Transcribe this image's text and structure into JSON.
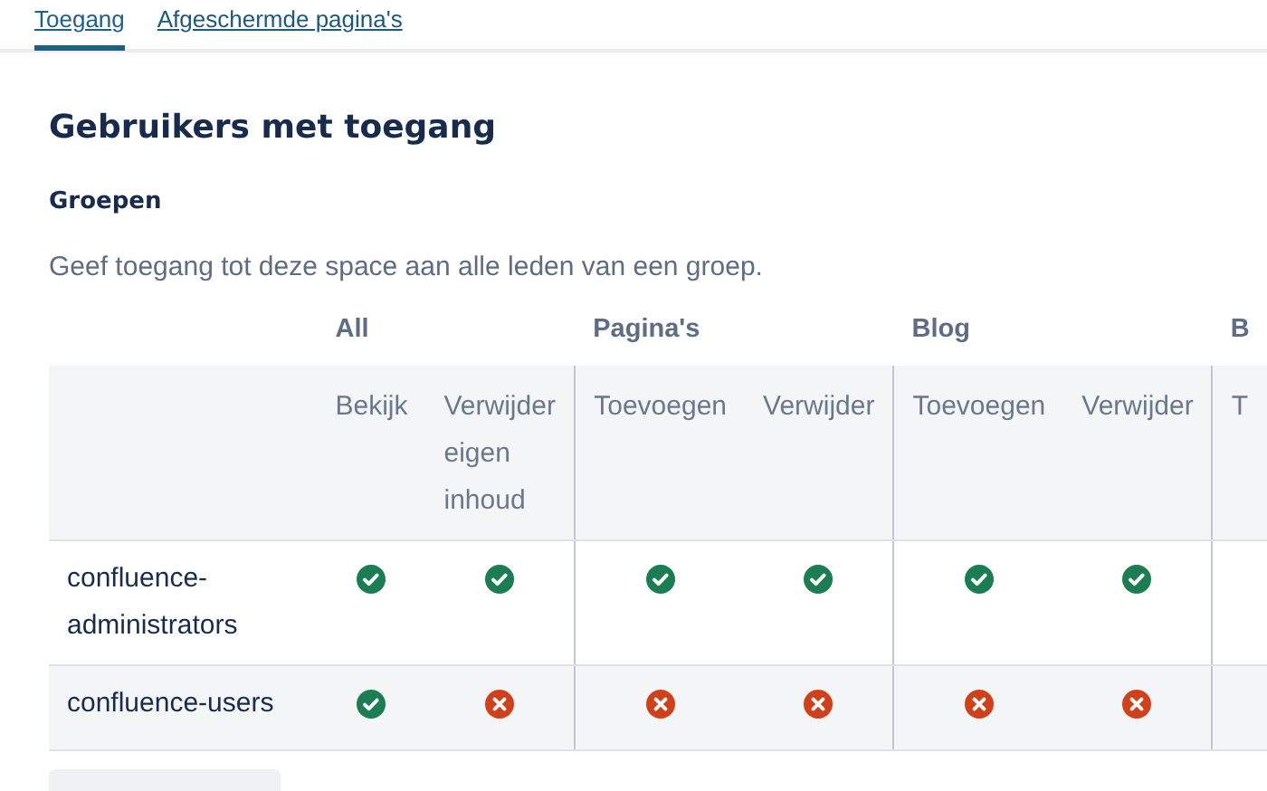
{
  "tabs": [
    {
      "label": "Toegang",
      "selected": true
    },
    {
      "label": "Afgeschermde pagina's",
      "selected": false
    }
  ],
  "heading": "Gebruikers met toegang",
  "section": {
    "title": "Groepen",
    "description": "Geef toegang tot deze space aan alle leden van een groep."
  },
  "table": {
    "groups": [
      {
        "label": "All",
        "columns": [
          "Bekijk",
          "Verwijder eigen inhoud"
        ]
      },
      {
        "label": "Pagina's",
        "columns": [
          "Toevoegen",
          "Verwijder"
        ]
      },
      {
        "label": "Blog",
        "columns": [
          "Toevoegen",
          "Verwijder"
        ]
      },
      {
        "label": "B",
        "columns": [
          "T"
        ]
      }
    ],
    "rows": [
      {
        "name": "confluence-administrators",
        "permissions": [
          true,
          true,
          true,
          true,
          true,
          true
        ]
      },
      {
        "name": "confluence-users",
        "permissions": [
          true,
          false,
          false,
          false,
          false,
          false
        ]
      }
    ]
  }
}
